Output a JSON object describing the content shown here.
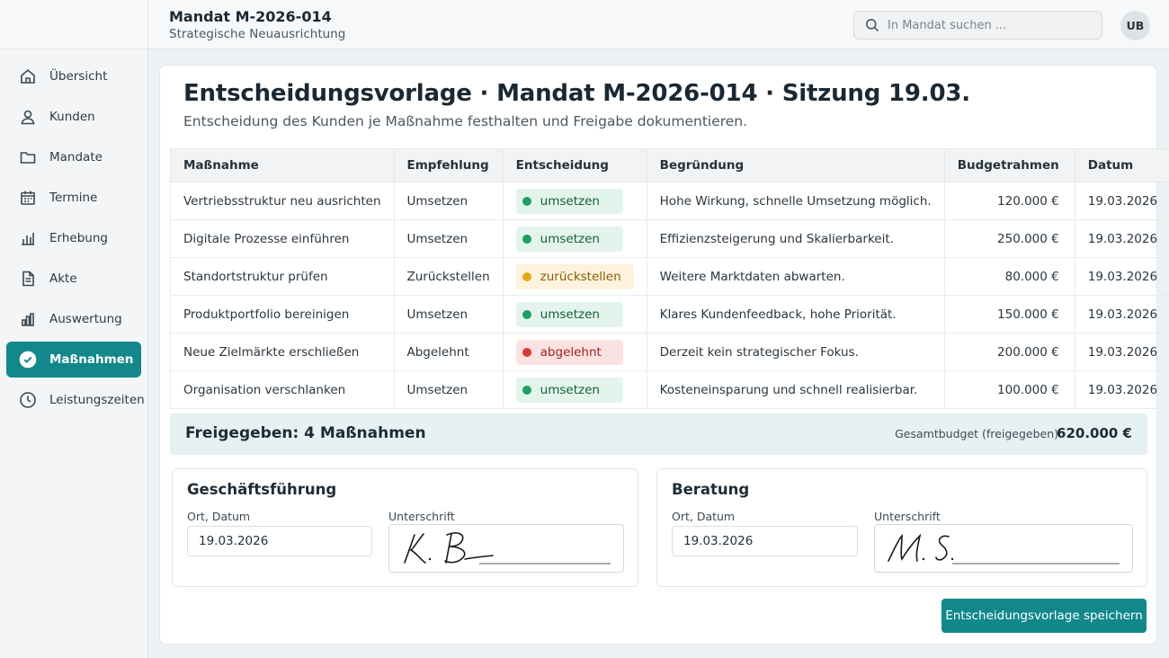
{
  "header": {
    "title": "Mandat M-2026-014",
    "subtitle": "Strategische Neuausrichtung",
    "search_placeholder": "In Mandat suchen ...",
    "user_initials": "UB"
  },
  "sidebar": {
    "items": [
      {
        "label": "Übersicht",
        "icon": "home-icon",
        "active": false
      },
      {
        "label": "Kunden",
        "icon": "user-icon",
        "active": false
      },
      {
        "label": "Mandate",
        "icon": "folder-icon",
        "active": false
      },
      {
        "label": "Termine",
        "icon": "calendar-icon",
        "active": false
      },
      {
        "label": "Erhebung",
        "icon": "bar-chart-icon",
        "active": false
      },
      {
        "label": "Akte",
        "icon": "document-icon",
        "active": false
      },
      {
        "label": "Auswertung",
        "icon": "analytics-icon",
        "active": false
      },
      {
        "label": "Maßnahmen",
        "icon": "check-circle-icon",
        "active": true
      },
      {
        "label": "Leistungszeiten",
        "icon": "clock-icon",
        "active": false
      }
    ]
  },
  "page": {
    "title": "Entscheidungsvorlage · Mandat M-2026-014 · Sitzung 19.03.",
    "subtitle": "Entscheidung des Kunden je Maßnahme festhalten und Freigabe dokumentieren."
  },
  "table": {
    "columns": [
      "Maßnahme",
      "Empfehlung",
      "Entscheidung",
      "Begründung",
      "Budgetrahmen",
      "Datum"
    ],
    "rows": [
      {
        "massnahme": "Vertriebsstruktur neu ausrichten",
        "empfehlung": "Umsetzen",
        "entscheidung": "umsetzen",
        "status": "green",
        "begruendung": "Hohe Wirkung, schnelle Umsetzung möglich.",
        "budget": "120.000 €",
        "datum": "19.03.2026"
      },
      {
        "massnahme": "Digitale Prozesse einführen",
        "empfehlung": "Umsetzen",
        "entscheidung": "umsetzen",
        "status": "green",
        "begruendung": "Effizienzsteigerung und Skalierbarkeit.",
        "budget": "250.000 €",
        "datum": "19.03.2026"
      },
      {
        "massnahme": "Standortstruktur prüfen",
        "empfehlung": "Zurückstellen",
        "entscheidung": "zurückstellen",
        "status": "yellow",
        "begruendung": "Weitere Marktdaten abwarten.",
        "budget": "80.000 €",
        "datum": "19.03.2026"
      },
      {
        "massnahme": "Produktportfolio bereinigen",
        "empfehlung": "Umsetzen",
        "entscheidung": "umsetzen",
        "status": "green",
        "begruendung": "Klares Kundenfeedback, hohe Priorität.",
        "budget": "150.000 €",
        "datum": "19.03.2026"
      },
      {
        "massnahme": "Neue Zielmärkte erschließen",
        "empfehlung": "Abgelehnt",
        "entscheidung": "abgelehnt",
        "status": "red",
        "begruendung": "Derzeit kein strategischer Fokus.",
        "budget": "200.000 €",
        "datum": "19.03.2026"
      },
      {
        "massnahme": "Organisation verschlanken",
        "empfehlung": "Umsetzen",
        "entscheidung": "umsetzen",
        "status": "green",
        "begruendung": "Kosteneinsparung und schnell realisierbar.",
        "budget": "100.000 €",
        "datum": "19.03.2026"
      }
    ]
  },
  "summary": {
    "approved": "Freigegeben: 4 Maßnahmen",
    "total_label": "Gesamtbudget (freigegeben)",
    "total_value": "620.000 €"
  },
  "signatures": [
    {
      "title": "Geschäftsführung",
      "date_label": "Ort, Datum",
      "date_value": "19.03.2026",
      "sign_label": "Unterschrift",
      "signature": "K. B"
    },
    {
      "title": "Beratung",
      "date_label": "Ort, Datum",
      "date_value": "19.03.2026",
      "sign_label": "Unterschrift",
      "signature": "M. S."
    }
  ],
  "actions": {
    "save_label": "Entscheidungsvorlage speichern"
  },
  "colors": {
    "accent": "#12888a",
    "status_green": "#1f9e5e",
    "status_yellow": "#e3a712",
    "status_red": "#d63a3a"
  }
}
